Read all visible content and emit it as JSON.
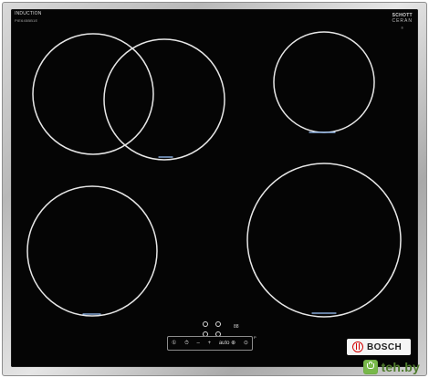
{
  "appliance": {
    "top_left_label": "INDUCTION",
    "top_left_sub": "PIE645BB1E",
    "schott_line_1": "SCHOTT",
    "schott_line_2": "CERAN",
    "schott_mark": "®",
    "controls": {
      "left": "①",
      "timer": "⏱",
      "minus": "–",
      "plus": "+",
      "boost": "auto ⊕",
      "right": "⊙"
    },
    "small_indicator": "88",
    "tiny_mark": "P",
    "bosch_label": "BOSCH"
  },
  "watermark": {
    "text": "teh.by"
  },
  "colors": {
    "glass": "#050505",
    "frame": "#bdbdbd",
    "zone_line": "#e7e7e7",
    "bosch_red": "#d30000",
    "watermark_green": "#78b84a"
  },
  "icons": {
    "bosch_logo": "bosch-logo-icon",
    "watermark": "shopping-bag-icon"
  }
}
